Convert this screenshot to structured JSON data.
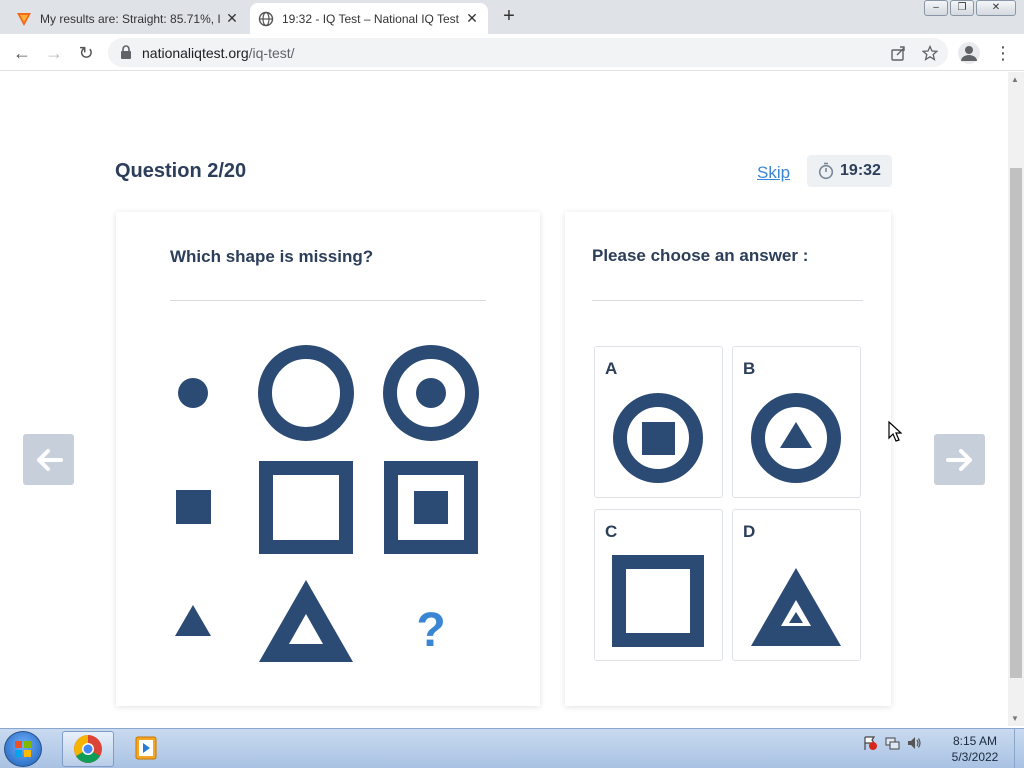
{
  "browser": {
    "tabs": [
      {
        "title": "My results are: Straight: 85.71%, I",
        "active": false
      },
      {
        "title": "19:32 - IQ Test – National IQ Test",
        "active": true
      }
    ],
    "url": {
      "domain": "nationaliqtest.org",
      "path": "/iq-test/"
    }
  },
  "quiz": {
    "question_label": "Question 2/20",
    "skip_label": "Skip",
    "timer": "19:32",
    "prompt": "Which shape is missing?",
    "answer_prompt": "Please choose an answer :",
    "missing_mark": "?",
    "answers": [
      {
        "letter": "A",
        "shape": "circle-ring-with-square"
      },
      {
        "letter": "B",
        "shape": "circle-ring-with-triangle"
      },
      {
        "letter": "C",
        "shape": "square-outline"
      },
      {
        "letter": "D",
        "shape": "triangle-with-triangle"
      }
    ]
  },
  "taskbar": {
    "time": "8:15 AM",
    "date": "5/3/2022"
  },
  "colors": {
    "shape": "#2b4a74",
    "accent": "#3a86d4",
    "nav_arrow": "#c7d0da"
  }
}
